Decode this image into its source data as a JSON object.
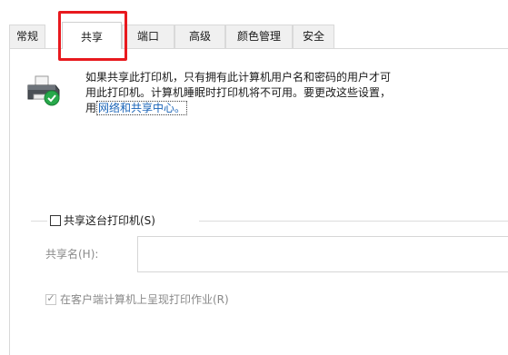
{
  "tabs": [
    {
      "id": "general",
      "label": "常规",
      "active": false
    },
    {
      "id": "sharing",
      "label": "共享",
      "active": true
    },
    {
      "id": "ports",
      "label": "端口",
      "active": false
    },
    {
      "id": "advanced",
      "label": "高级",
      "active": false
    },
    {
      "id": "color-management",
      "label": "颜色管理",
      "active": false
    },
    {
      "id": "security",
      "label": "安全",
      "active": false
    }
  ],
  "info": {
    "icon": "printer-shared-icon",
    "line1": "如果共享此打印机，只有拥有此计算机用户名和密码的用户才可",
    "line2": "用此打印机。计算机睡眠时打印机将不可用。要更改这些设置，",
    "line3_prefix": "用",
    "link_text": "网络和共享中心。"
  },
  "share_printer": {
    "label": "共享这台打印机(S)",
    "checked": false
  },
  "share_name": {
    "label": "共享名(H):",
    "value": "",
    "disabled": true
  },
  "render_jobs": {
    "label": "在客户端计算机上呈现打印作业(R)",
    "checked": true,
    "disabled": true
  },
  "colors": {
    "highlight": "#e8191e",
    "link": "#1a64b8",
    "disabled_text": "#8a8a8a"
  }
}
